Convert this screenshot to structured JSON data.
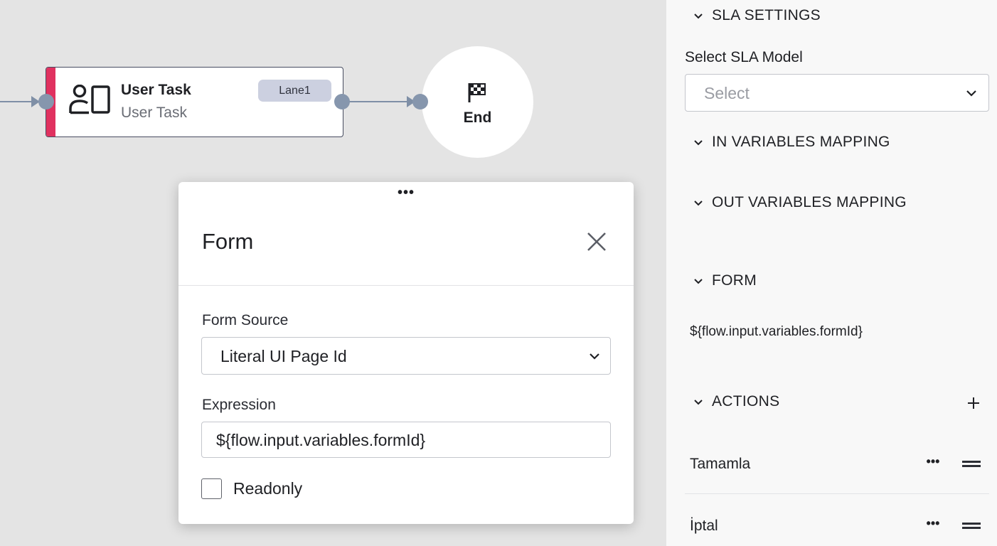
{
  "canvas": {
    "task": {
      "title": "User Task",
      "subtitle": "User Task",
      "lane": "Lane1"
    },
    "end": {
      "label": "End"
    }
  },
  "modal": {
    "title": "Form",
    "form_source_label": "Form Source",
    "form_source_value": "Literal UI Page Id",
    "expression_label": "Expression",
    "expression_value": "${flow.input.variables.formId}",
    "readonly_label": "Readonly",
    "readonly_checked": false
  },
  "panel": {
    "sla": {
      "header": "SLA SETTINGS",
      "model_label": "Select SLA Model",
      "model_placeholder": "Select"
    },
    "in_vars": {
      "header": "IN VARIABLES MAPPING"
    },
    "out_vars": {
      "header": "OUT VARIABLES MAPPING"
    },
    "form": {
      "header": "FORM",
      "expression": "${flow.input.variables.formId}"
    },
    "actions": {
      "header": "ACTIONS",
      "items": [
        {
          "label": "Tamamla"
        },
        {
          "label": "İptal"
        }
      ]
    }
  },
  "colors": {
    "canvas_bg": "#e4e4e4",
    "task_accent": "#e0315f",
    "connector": "#7f8fa6",
    "lane_badge": "#ccd0e0",
    "panel_bg": "#f8f8f8"
  },
  "icons": {
    "task": "user-task-icon",
    "end": "checkered-flag-icon",
    "close": "close-icon",
    "chevron": "chevron-down-icon",
    "add": "plus-icon",
    "more": "more-horizontal-icon",
    "drag": "drag-handle-icon"
  }
}
